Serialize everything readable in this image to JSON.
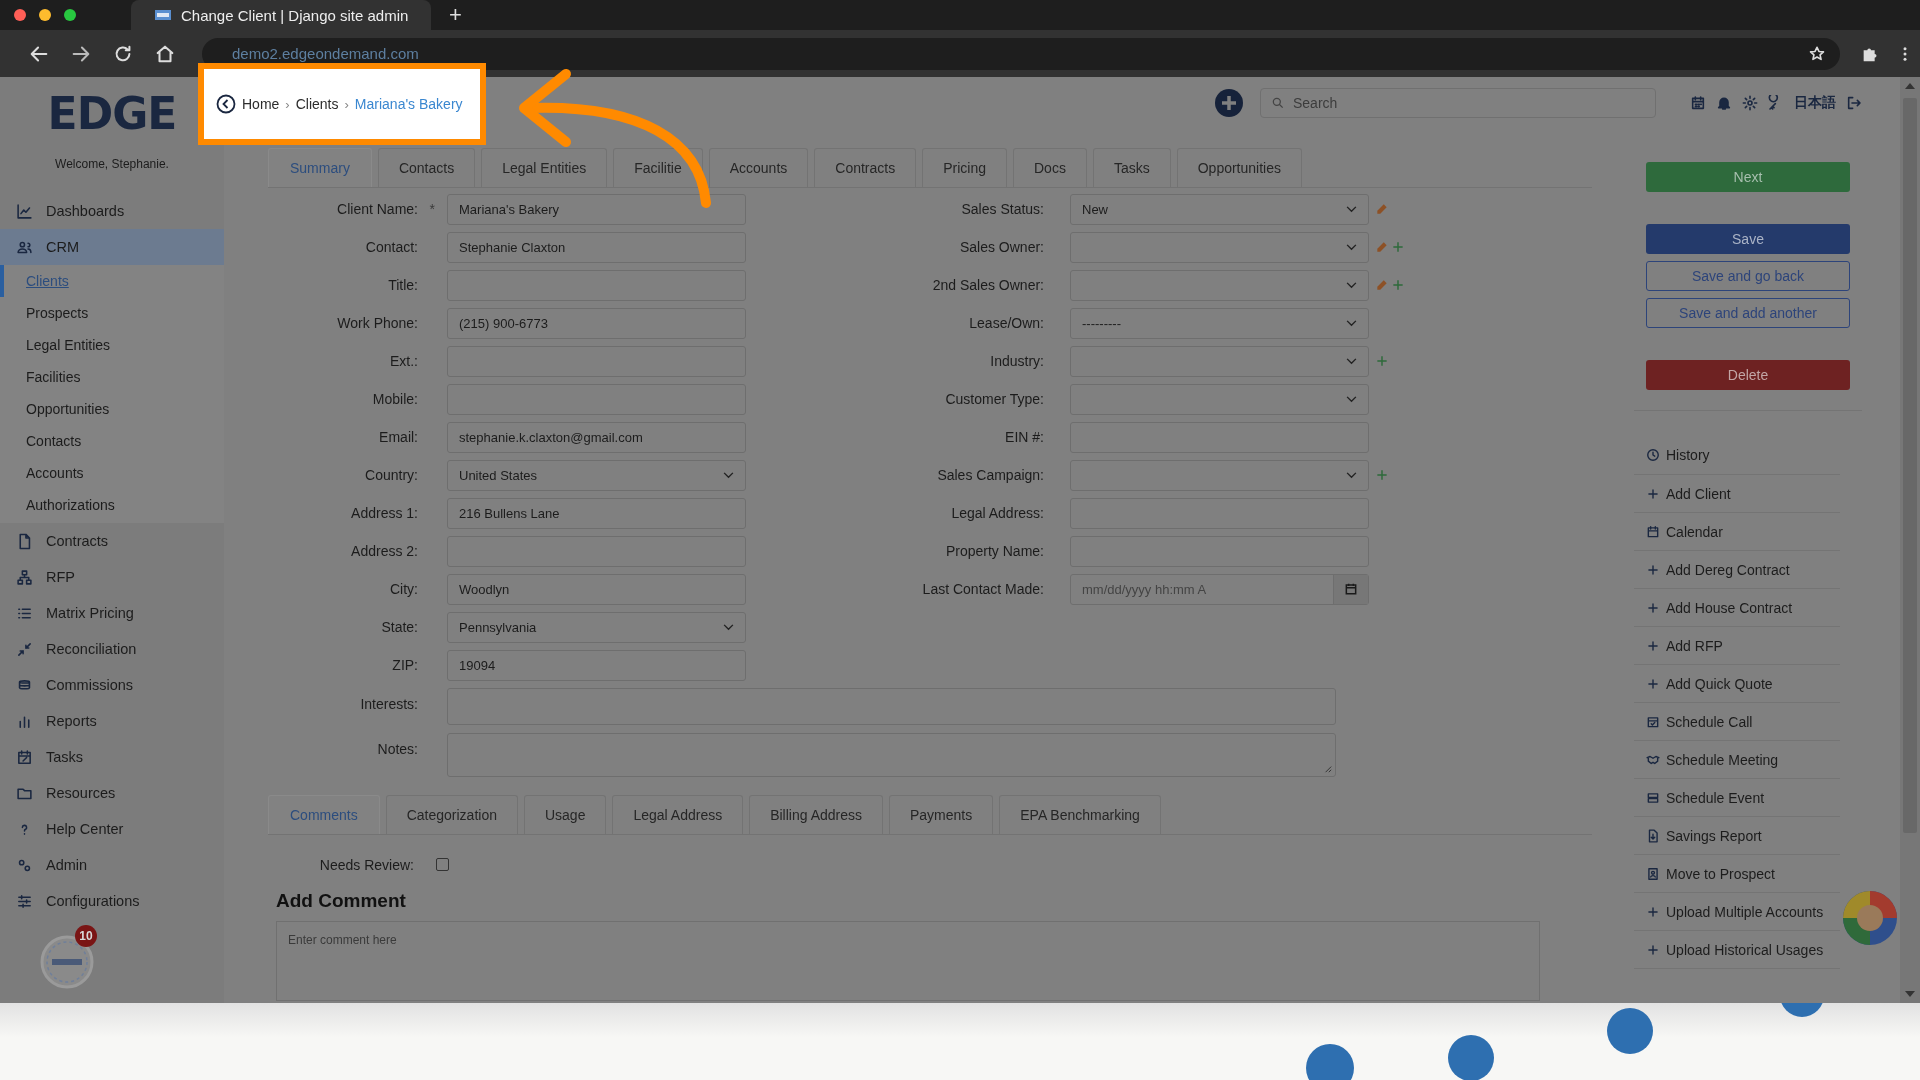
{
  "browser": {
    "tab_title": "Change Client | Django site admin",
    "new_tab": "+",
    "url": "demo2.edgeondemand.com"
  },
  "logo": "EDGE",
  "welcome": "Welcome, Stephanie.",
  "breadcrumb": [
    {
      "label": "Home",
      "current": false
    },
    {
      "separator": "›",
      "label": "Clients",
      "current": false
    },
    {
      "separator": "›",
      "label": "Mariana's Bakery",
      "current": true
    }
  ],
  "header": {
    "search_placeholder": "Search",
    "language": "日本語"
  },
  "sidebar": [
    {
      "label": "Dashboards",
      "selected": false
    },
    {
      "label": "CRM",
      "selected": true,
      "children": [
        {
          "label": "Clients",
          "selected": true
        },
        {
          "label": "Prospects",
          "selected": false
        },
        {
          "label": "Legal Entities",
          "selected": false
        },
        {
          "label": "Facilities",
          "selected": false
        },
        {
          "label": "Opportunities",
          "selected": false
        },
        {
          "label": "Contacts",
          "selected": false
        },
        {
          "label": "Accounts",
          "selected": false
        },
        {
          "label": "Authorizations",
          "selected": false
        }
      ]
    },
    {
      "label": "Contracts",
      "selected": false
    },
    {
      "label": "RFP",
      "selected": false
    },
    {
      "label": "Matrix Pricing",
      "selected": false
    },
    {
      "label": "Reconciliation",
      "selected": false
    },
    {
      "label": "Commissions",
      "selected": false
    },
    {
      "label": "Reports",
      "selected": false
    },
    {
      "label": "Tasks",
      "selected": false
    },
    {
      "label": "Resources",
      "selected": false
    },
    {
      "label": "Help Center",
      "selected": false
    },
    {
      "label": "Admin",
      "selected": false
    },
    {
      "label": "Configurations",
      "selected": false
    }
  ],
  "notification_count": "10",
  "tabs": [
    {
      "label": "Summary",
      "selected": true
    },
    {
      "label": "Contacts",
      "selected": false
    },
    {
      "label": "Legal Entities",
      "selected": false
    },
    {
      "label": "Facilitie",
      "selected": false
    },
    {
      "label": "Accounts",
      "selected": false
    },
    {
      "label": "Contracts",
      "selected": false
    },
    {
      "label": "Pricing",
      "selected": false
    },
    {
      "label": "Docs",
      "selected": false
    },
    {
      "label": "Tasks",
      "selected": false
    },
    {
      "label": "Opportunities",
      "selected": false
    }
  ],
  "left_fields": [
    {
      "label": "Client Name:",
      "required_mark": "*",
      "kind": "text",
      "value": "Mariana's Bakery"
    },
    {
      "label": "Contact:",
      "kind": "text",
      "value": "Stephanie Claxton"
    },
    {
      "label": "Title:",
      "kind": "text"
    },
    {
      "label": "Work Phone:",
      "kind": "text",
      "value": "(215) 900-6773"
    },
    {
      "label": "Ext.:",
      "kind": "text"
    },
    {
      "label": "Mobile:",
      "kind": "text"
    },
    {
      "label": "Email:",
      "kind": "text",
      "value": "stephanie.k.claxton@gmail.com"
    },
    {
      "label": "Country:",
      "kind": "select",
      "value": "United States"
    },
    {
      "label": "Address 1:",
      "kind": "text",
      "value": "216 Bullens Lane"
    },
    {
      "label": "Address 2:",
      "kind": "text"
    },
    {
      "label": "City:",
      "kind": "text",
      "value": "Woodlyn"
    },
    {
      "label": "State:",
      "kind": "select",
      "value": "Pennsylvania"
    },
    {
      "label": "ZIP:",
      "kind": "text",
      "value": "19094"
    }
  ],
  "right_fields": [
    {
      "label": "Sales Status:",
      "kind": "select",
      "value": "New",
      "edit": true,
      "add": false
    },
    {
      "label": "Sales Owner:",
      "kind": "select",
      "edit": true,
      "add": true
    },
    {
      "label": "2nd Sales Owner:",
      "kind": "select",
      "edit": true,
      "add": true
    },
    {
      "label": "Lease/Own:",
      "kind": "select",
      "value": "---------",
      "edit": false,
      "add": false
    },
    {
      "label": "Industry:",
      "kind": "select",
      "edit": false,
      "add": true
    },
    {
      "label": "Customer Type:",
      "kind": "select",
      "edit": false,
      "add": false
    },
    {
      "label": "EIN #:",
      "kind": "text",
      "edit": false,
      "add": false
    },
    {
      "label": "Sales Campaign:",
      "kind": "select",
      "edit": false,
      "add": true
    },
    {
      "label": "Legal Address:",
      "kind": "text",
      "edit": false,
      "add": false
    },
    {
      "label": "Property Name:",
      "kind": "text",
      "edit": false,
      "add": false
    },
    {
      "label": "Last Contact Made:",
      "kind": "date",
      "placeholder": "mm/dd/yyyy hh:mm A",
      "edit": false,
      "add": false
    }
  ],
  "wide_fields": [
    {
      "label": "Interests:"
    },
    {
      "label": "Notes:"
    }
  ],
  "bottom_tabs": [
    {
      "label": "Comments",
      "selected": true
    },
    {
      "label": "Categorization",
      "selected": false
    },
    {
      "label": "Usage",
      "selected": false
    },
    {
      "label": "Legal Address",
      "selected": false
    },
    {
      "label": "Billing Address",
      "selected": false
    },
    {
      "label": "Payments",
      "selected": false
    },
    {
      "label": "EPA Benchmarking",
      "selected": false
    }
  ],
  "needs_review": {
    "label": "Needs Review:",
    "checked": false
  },
  "comment": {
    "title": "Add Comment",
    "placeholder": "Enter comment here"
  },
  "buttons": [
    {
      "label": "Next",
      "kind": "success"
    },
    {
      "label": "Save",
      "kind": "primary"
    },
    {
      "label": "Save and go back",
      "kind": "outline"
    },
    {
      "label": "Save and add another",
      "kind": "outline"
    },
    {
      "label": "Delete",
      "kind": "danger"
    }
  ],
  "links": [
    {
      "label": "History"
    },
    {
      "label": "Add Client"
    },
    {
      "label": "Calendar"
    },
    {
      "label": "Add Dereg Contract"
    },
    {
      "label": "Add House Contract"
    },
    {
      "label": "Add RFP"
    },
    {
      "label": "Add Quick Quote"
    },
    {
      "label": "Schedule Call"
    },
    {
      "label": "Schedule Meeting"
    },
    {
      "label": "Schedule Event"
    },
    {
      "label": "Savings Report"
    },
    {
      "label": "Move to Prospect"
    },
    {
      "label": "Upload Multiple Accounts"
    },
    {
      "label": "Upload Historical Usages"
    }
  ]
}
